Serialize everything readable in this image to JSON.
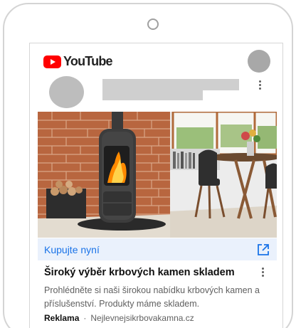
{
  "header": {
    "logo_text": "YouTube",
    "logo_color": "#ff0000"
  },
  "ad": {
    "cta_label": "Kupujte nyní",
    "cta_icon": "open-in-new-icon",
    "title": "Široký výběr krbových kamen skladem",
    "description": "Prohlédněte si naši širokou nabídku krbových kamen a příslušenství. Produkty máme skladem.",
    "badge": "Reklama",
    "separator": "·",
    "domain": "Nejlevnejsikrbovakamna.cz",
    "accent_color": "#1a73e8",
    "cta_background": "#eaf1fc"
  }
}
